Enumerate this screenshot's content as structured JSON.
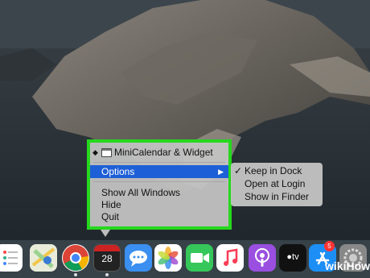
{
  "menu": {
    "title": "MiniCalendar & Widget",
    "items": [
      {
        "label": "Options",
        "highlighted": true
      },
      {
        "label": "Show All Windows"
      },
      {
        "label": "Hide"
      },
      {
        "label": "Quit"
      }
    ]
  },
  "submenu": {
    "items": [
      {
        "label": "Keep in Dock",
        "checked": true
      },
      {
        "label": "Open at Login"
      },
      {
        "label": "Show in Finder"
      }
    ]
  },
  "dock": {
    "icons": [
      "reminders-icon",
      "maps-icon",
      "chrome-icon",
      "minicalendar-icon",
      "messages-icon",
      "photos-icon",
      "facetime-icon",
      "music-icon",
      "podcasts-icon",
      "apple-tv-icon",
      "app-store-icon",
      "system-preferences-icon"
    ],
    "calendar_date": "28",
    "app_store_badge": "5"
  },
  "colors": {
    "highlight": "#1d5fd6",
    "frame": "#27d81e"
  },
  "watermark": {
    "part1": "wiki",
    "part2": "How"
  }
}
